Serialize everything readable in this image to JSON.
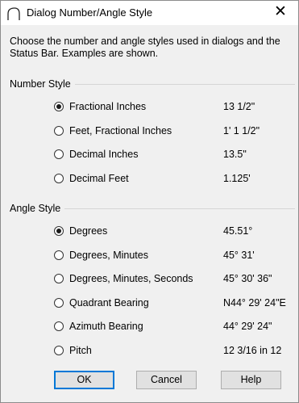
{
  "window": {
    "title": "Dialog Number/Angle Style",
    "close_glyph": "✕"
  },
  "intro": "Choose the number and angle styles used in dialogs and the Status Bar.  Examples are shown.",
  "number_style": {
    "label": "Number Style",
    "options": [
      {
        "label": "Fractional Inches",
        "example": "13 1/2\"",
        "selected": true
      },
      {
        "label": "Feet, Fractional Inches",
        "example": "1' 1 1/2\"",
        "selected": false
      },
      {
        "label": "Decimal Inches",
        "example": "13.5\"",
        "selected": false
      },
      {
        "label": "Decimal Feet",
        "example": "1.125'",
        "selected": false
      }
    ]
  },
  "angle_style": {
    "label": "Angle Style",
    "options": [
      {
        "label": "Degrees",
        "example": "45.51°",
        "selected": true
      },
      {
        "label": "Degrees, Minutes",
        "example": "45° 31'",
        "selected": false
      },
      {
        "label": "Degrees, Minutes, Seconds",
        "example": "45° 30' 36\"",
        "selected": false
      },
      {
        "label": "Quadrant Bearing",
        "example": "N44° 29' 24\"E",
        "selected": false
      },
      {
        "label": "Azimuth Bearing",
        "example": "44° 29' 24\"",
        "selected": false
      },
      {
        "label": "Pitch",
        "example": "12 3/16 in 12",
        "selected": false
      }
    ]
  },
  "buttons": {
    "ok": "OK",
    "cancel": "Cancel",
    "help": "Help"
  }
}
